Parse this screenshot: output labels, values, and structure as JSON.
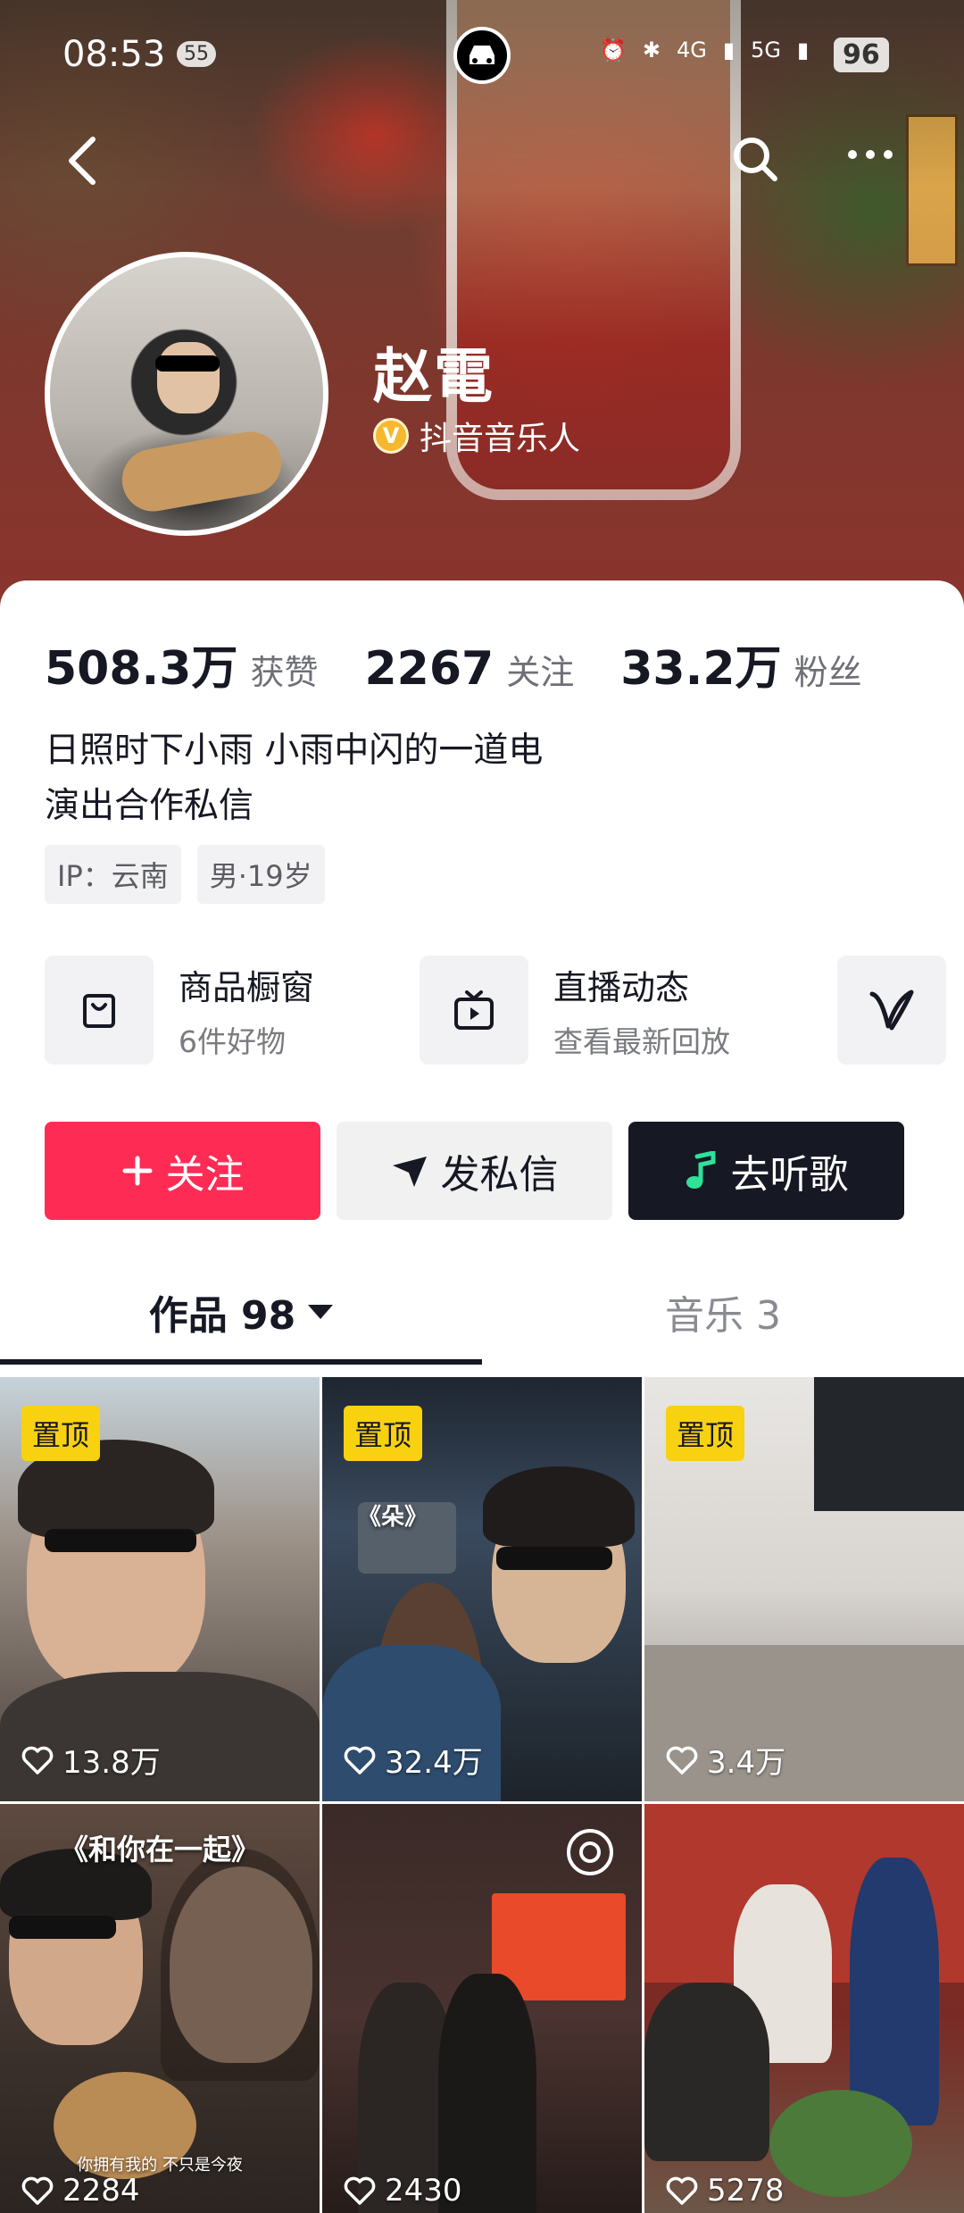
{
  "status_bar": {
    "time": "08:53",
    "notification_count": "55",
    "network_1": "4G",
    "network_2": "5G",
    "battery": "96"
  },
  "profile": {
    "name": "赵電",
    "verification": "抖音音乐人",
    "verification_badge": "V",
    "bio_line_1": "日照时下小雨 小雨中闪的一道电",
    "bio_line_2": "演出合作私信",
    "tags": [
      "IP：云南",
      "男·19岁"
    ]
  },
  "stats": [
    {
      "value": "508.3万",
      "label": "获赞"
    },
    {
      "value": "2267",
      "label": "关注"
    },
    {
      "value": "33.2万",
      "label": "粉丝"
    }
  ],
  "features": {
    "shop": {
      "title": "商品橱窗",
      "subtitle": "6件好物",
      "icon": "shopping-bag-icon"
    },
    "live": {
      "title": "直播动态",
      "subtitle": "查看最新回放",
      "icon": "tv-play-icon"
    },
    "music_icon": "music-v-icon"
  },
  "actions": {
    "follow": "关注",
    "message": "发私信",
    "listen": "去听歌"
  },
  "tabs": {
    "works": "作品 98",
    "music": "音乐 3"
  },
  "videos": [
    {
      "pinned": true,
      "pin_label": "置顶",
      "likes": "13.8万",
      "overlay": ""
    },
    {
      "pinned": true,
      "pin_label": "置顶",
      "likes": "32.4万",
      "overlay": "《朵》"
    },
    {
      "pinned": true,
      "pin_label": "置顶",
      "likes": "3.4万",
      "overlay": ""
    },
    {
      "pinned": false,
      "pin_label": "",
      "likes": "2284",
      "overlay": "《和你在一起》",
      "caption": "你拥有我的 不只是今夜"
    },
    {
      "pinned": false,
      "pin_label": "",
      "likes": "2430",
      "overlay": ""
    },
    {
      "pinned": false,
      "pin_label": "",
      "likes": "5278",
      "overlay": ""
    }
  ],
  "colors": {
    "accent_red": "#fe2c55",
    "dark": "#161823",
    "pin_yellow": "#f8d210",
    "verify_gold": "#f5b82e"
  }
}
